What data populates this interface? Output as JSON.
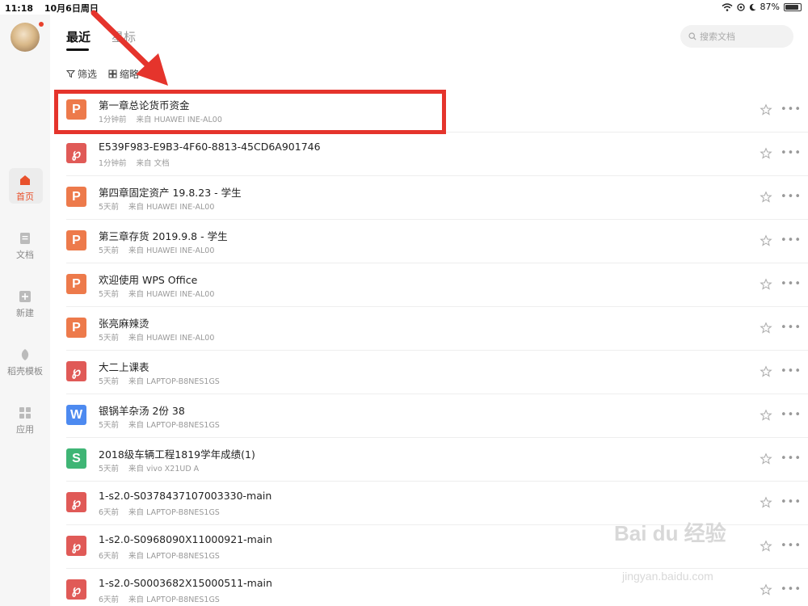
{
  "status_bar": {
    "time": "11:18",
    "date": "10月6日周日",
    "battery": "87%"
  },
  "sidebar": {
    "items": [
      {
        "label": "首页",
        "icon": "home-icon"
      },
      {
        "label": "文档",
        "icon": "document-icon"
      },
      {
        "label": "新建",
        "icon": "plus-icon"
      },
      {
        "label": "稻壳模板",
        "icon": "leaf-icon"
      },
      {
        "label": "应用",
        "icon": "apps-grid-icon"
      }
    ]
  },
  "tabs": [
    "最近",
    "星标"
  ],
  "search": {
    "placeholder": "搜索文档"
  },
  "toolbar": {
    "filter": "筛选",
    "thumbnail": "缩略"
  },
  "files": [
    {
      "name": "第一章总论货币资金",
      "time": "1分钟前",
      "source": "来自 HUAWEI INE-AL00",
      "type": "ppt",
      "glyph": "P"
    },
    {
      "name": "E539F983-E9B3-4F60-8813-45CD6A901746",
      "time": "1分钟前",
      "source": "来自 文档",
      "type": "pdf",
      "glyph": "℘"
    },
    {
      "name": "第四章固定资产 19.8.23 - 学生",
      "time": "5天前",
      "source": "来自 HUAWEI INE-AL00",
      "type": "ppt",
      "glyph": "P"
    },
    {
      "name": "第三章存货 2019.9.8 - 学生",
      "time": "5天前",
      "source": "来自 HUAWEI INE-AL00",
      "type": "ppt",
      "glyph": "P"
    },
    {
      "name": "欢迎使用 WPS Office",
      "time": "5天前",
      "source": "来自 HUAWEI INE-AL00",
      "type": "ppt",
      "glyph": "P"
    },
    {
      "name": "张亮麻辣烫",
      "time": "5天前",
      "source": "来自 HUAWEI INE-AL00",
      "type": "ppt",
      "glyph": "P"
    },
    {
      "name": "大二上课表",
      "time": "5天前",
      "source": "来自 LAPTOP-B8NES1GS",
      "type": "pdf",
      "glyph": "℘"
    },
    {
      "name": "银锅羊杂汤 2份 38",
      "time": "5天前",
      "source": "来自 LAPTOP-B8NES1GS",
      "type": "word",
      "glyph": "W"
    },
    {
      "name": "2018级车辆工程1819学年成绩(1)",
      "time": "5天前",
      "source": "来自 vivo X21UD A",
      "type": "sheet",
      "glyph": "S"
    },
    {
      "name": "1-s2.0-S0378437107003330-main",
      "time": "6天前",
      "source": "来自 LAPTOP-B8NES1GS",
      "type": "pdf",
      "glyph": "℘"
    },
    {
      "name": "1-s2.0-S0968090X11000921-main",
      "time": "6天前",
      "source": "来自 LAPTOP-B8NES1GS",
      "type": "pdf",
      "glyph": "℘"
    },
    {
      "name": "1-s2.0-S0003682X15000511-main",
      "time": "6天前",
      "source": "来自 LAPTOP-B8NES1GS",
      "type": "pdf",
      "glyph": "℘"
    }
  ],
  "watermark": {
    "brand": "Bai du 经验",
    "url": "jingyan.baidu.com"
  },
  "colors": {
    "accent": "#e8512c",
    "highlight": "#e5342c",
    "ppt": "#ed7a4b",
    "pdf": "#e05a57",
    "word": "#4d8af0",
    "sheet": "#3fb575"
  }
}
